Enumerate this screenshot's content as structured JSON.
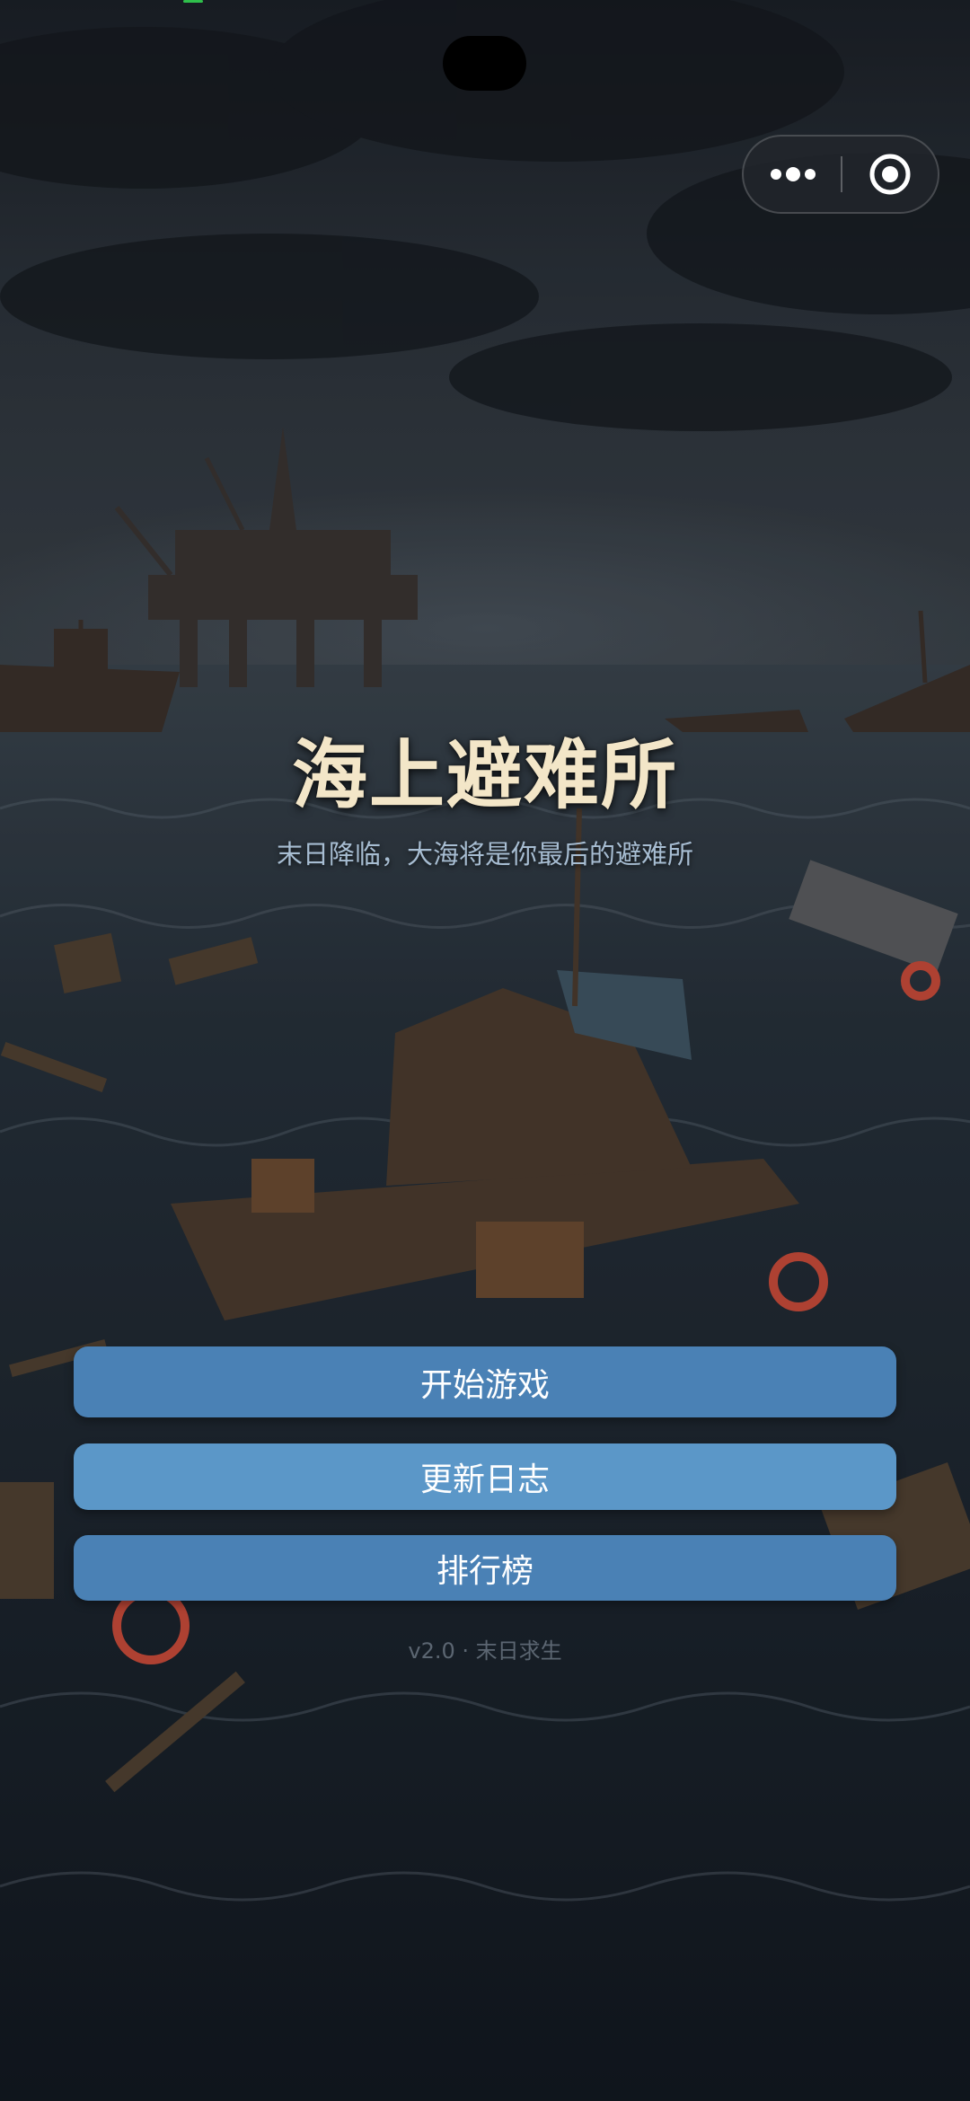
{
  "game": {
    "title": "海上避难所",
    "subtitle": "末日降临，大海将是你最后的避难所"
  },
  "menu": {
    "start_label": "开始游戏",
    "changelog_label": "更新日志",
    "leaderboard_label": "排行榜"
  },
  "footer": {
    "version_text": "v2.0 · 末日求生"
  },
  "capsule": {
    "more_icon": "more-dots-icon",
    "close_icon": "target-close-icon"
  },
  "colors": {
    "title": "#f3e6c8",
    "subtitle": "#a7bdd2",
    "button_primary": "#4a81b5",
    "button_secondary": "#5b97c8"
  }
}
